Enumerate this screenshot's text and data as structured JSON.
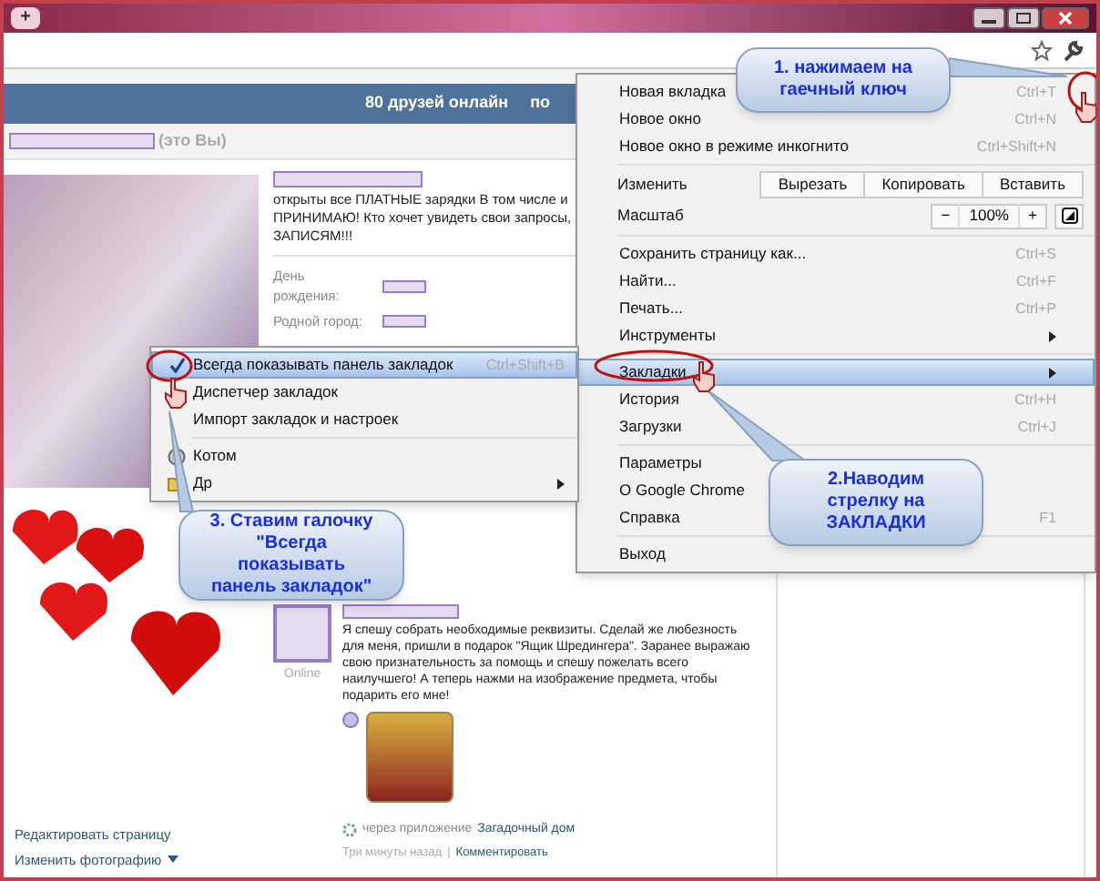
{
  "window": {
    "new_tab": "+"
  },
  "page": {
    "header": {
      "friends_online": "80 друзей онлайн",
      "link_2": "по"
    },
    "profile": {
      "you_label": "(это Вы)",
      "status_lines": [
        "открыты все ПЛАТНЫЕ зарядки В том числе и",
        "ПРИНИМАЮ! Кто хочет увидеть свои запросы,",
        "ЗАПИСЯМ!!!"
      ],
      "fields": [
        {
          "label": "День рождения:"
        },
        {
          "label": "Родной город:"
        }
      ]
    },
    "left_links": [
      {
        "label": "Редактировать страницу",
        "dropdown": false
      },
      {
        "label": "Изменить фотографию",
        "dropdown": true
      }
    ],
    "post": {
      "online": "Online",
      "text": "Я спешу собрать необходимые реквизиты. Сделай же любезность для меня, пришли в подарок \"Ящик Шредингера\". Заранее выражаю свою признательность за помощь и спешу пожелать всего наилучшего! А теперь нажми на изображение предмета, чтобы подарить его мне!",
      "via": "через приложение",
      "app": "Загадочный дом",
      "time": "Три минуты назад",
      "separator": "|",
      "comment": "Комментировать"
    }
  },
  "menu": {
    "items": [
      {
        "kind": "item",
        "label": "Новая вкладка",
        "shortcut": "Ctrl+T",
        "selected": false,
        "submenu": false
      },
      {
        "kind": "item",
        "label": "Новое окно",
        "shortcut": "Ctrl+N",
        "selected": false,
        "submenu": false
      },
      {
        "kind": "item",
        "label": "Новое окно в режиме инкогнито",
        "shortcut": "Ctrl+Shift+N",
        "selected": false,
        "submenu": false
      },
      {
        "kind": "separator"
      },
      {
        "kind": "edit",
        "label": "Изменить",
        "buttons": [
          "Вырезать",
          "Копировать",
          "Вставить"
        ]
      },
      {
        "kind": "zoom",
        "label": "Масштаб",
        "minus": "−",
        "value": "100%",
        "plus": "+"
      },
      {
        "kind": "separator"
      },
      {
        "kind": "item",
        "label": "Сохранить страницу как...",
        "shortcut": "Ctrl+S",
        "selected": false,
        "submenu": false
      },
      {
        "kind": "item",
        "label": "Найти...",
        "shortcut": "Ctrl+F",
        "selected": false,
        "submenu": false
      },
      {
        "kind": "item",
        "label": "Печать...",
        "shortcut": "Ctrl+P",
        "selected": false,
        "submenu": false
      },
      {
        "kind": "item",
        "label": "Инструменты",
        "selected": false,
        "submenu": true
      },
      {
        "kind": "separator"
      },
      {
        "kind": "item",
        "label": "Закладки",
        "selected": true,
        "submenu": true
      },
      {
        "kind": "item",
        "label": "История",
        "shortcut": "Ctrl+H",
        "selected": false,
        "submenu": false
      },
      {
        "kind": "item",
        "label": "Загрузки",
        "shortcut": "Ctrl+J",
        "selected": false,
        "submenu": false
      },
      {
        "kind": "separator"
      },
      {
        "kind": "item",
        "label": "Параметры",
        "selected": false,
        "submenu": false
      },
      {
        "kind": "item",
        "label": "О Google Chrome",
        "selected": false,
        "submenu": false
      },
      {
        "kind": "item",
        "label": "Справка",
        "shortcut": "F1",
        "selected": false,
        "submenu": false
      },
      {
        "kind": "separator"
      },
      {
        "kind": "item",
        "label": "Выход",
        "selected": false,
        "submenu": false
      }
    ]
  },
  "submenu": {
    "items": [
      {
        "kind": "item",
        "label": "Всегда показывать панель закладок",
        "shortcut": "Ctrl+Shift+B",
        "checked": true,
        "selected": true,
        "submenu": false
      },
      {
        "kind": "item",
        "label": "Диспетчер закладок",
        "checked": false,
        "selected": false,
        "submenu": false
      },
      {
        "kind": "item",
        "label": "Импорт закладок и настроек",
        "checked": false,
        "selected": false,
        "submenu": false
      },
      {
        "kind": "separator"
      },
      {
        "kind": "site",
        "label": "Котом",
        "checked": false,
        "selected": false,
        "submenu": false
      },
      {
        "kind": "folder",
        "label": "Др",
        "checked": false,
        "selected": false,
        "submenu": true
      }
    ]
  },
  "callouts": [
    {
      "lines": [
        "1. нажимаем на",
        "гаечный ключ"
      ]
    },
    {
      "lines": [
        "2.Наводим",
        "стрелку на",
        "ЗАКЛАДКИ"
      ]
    },
    {
      "lines": [
        "3. Ставим галочку",
        "\"Всегда",
        "показывать",
        "панель закладок\""
      ]
    }
  ]
}
